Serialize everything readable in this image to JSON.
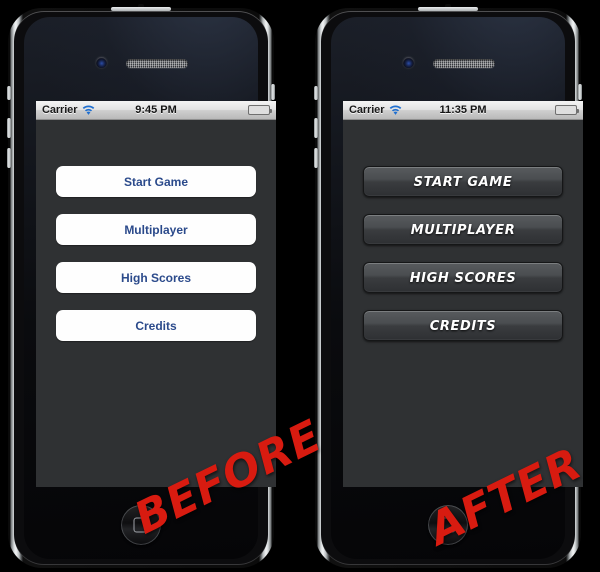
{
  "page": {
    "background_color": "#000000",
    "comparison_type": "before-after"
  },
  "phones": [
    {
      "id": "before",
      "watermark": "BEFORE",
      "watermark_color": "#d81b10",
      "status_bar": {
        "carrier": "Carrier",
        "wifi_icon": "wifi-icon",
        "time": "9:45 PM",
        "battery_icon": "battery-icon",
        "battery_color": "#73c91d",
        "background": "#e3e3e3"
      },
      "screen": {
        "background_color": "#2f3133",
        "button_style": "default-white-rounded",
        "button_text_color": "#2b4a8b",
        "buttons": [
          {
            "label": "Start Game"
          },
          {
            "label": "Multiplayer"
          },
          {
            "label": "High Scores"
          },
          {
            "label": "Credits"
          }
        ]
      },
      "hardware": {
        "camera_icon": "front-camera-icon",
        "speaker_icon": "earpiece-speaker-icon",
        "home_button_icon": "home-button-icon"
      }
    },
    {
      "id": "after",
      "watermark": "AFTER",
      "watermark_color": "#d81b10",
      "status_bar": {
        "carrier": "Carrier",
        "wifi_icon": "wifi-icon",
        "time": "11:35 PM",
        "battery_icon": "battery-icon",
        "battery_color": "#73c91d",
        "background": "#e3e3e3"
      },
      "screen": {
        "background_color": "#2f3133",
        "button_style": "custom-dark-gradient",
        "button_text_color": "#ffffff",
        "buttons": [
          {
            "label": "START GAME"
          },
          {
            "label": "MULTIPLAYER"
          },
          {
            "label": "HIGH SCORES"
          },
          {
            "label": "CREDITS"
          }
        ]
      },
      "hardware": {
        "camera_icon": "front-camera-icon",
        "speaker_icon": "earpiece-speaker-icon",
        "home_button_icon": "home-button-icon"
      }
    }
  ]
}
